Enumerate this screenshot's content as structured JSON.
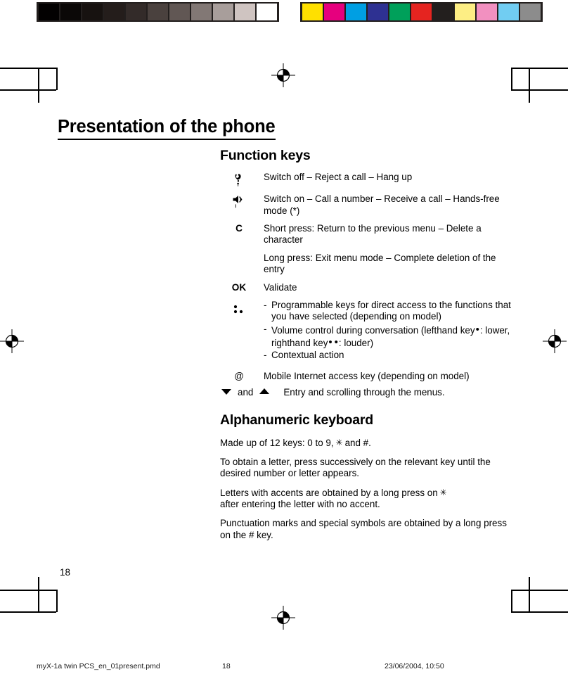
{
  "document": {
    "title": "Presentation of the phone",
    "page_number": "18"
  },
  "calibration": {
    "grayscale_swatches": [
      "#030101",
      "#0b0807",
      "#171210",
      "#241d1b",
      "#332b29",
      "#4a413e",
      "#615754",
      "#827875",
      "#a89e9b",
      "#cfc4c1",
      "#ffffff"
    ],
    "color_swatches": [
      "#ffe000",
      "#e6007e",
      "#009fe3",
      "#2e3192",
      "#00a05a",
      "#e52420",
      "#231f1e",
      "#fdee84",
      "#f290c0",
      "#71cdf2",
      "#8c8c8c"
    ]
  },
  "sections": [
    {
      "heading": "Function keys",
      "rows": [
        {
          "icon": "hangup-phone-icon",
          "key_label": "",
          "lines": [
            "Switch off – Reject a call – Hang up"
          ]
        },
        {
          "icon": "speaker-call-icon",
          "key_label": "",
          "lines": [
            "Switch on – Call a number – Receive a call – Hands-free mode (*)"
          ]
        },
        {
          "icon": "",
          "key_label": "C",
          "lines": [
            "Short press: Return to the previous menu – Delete a character"
          ]
        },
        {
          "icon": "",
          "key_label": "",
          "lines": [
            "Long press: Exit menu mode – Complete deletion of the entry"
          ]
        },
        {
          "icon": "",
          "key_label": "OK",
          "lines": [
            "Validate"
          ]
        }
      ],
      "soft_keys": {
        "icon": "three-dots-soft-keys-icon",
        "items": [
          "Programmable keys for direct access to the functions that you have selected (depending on model)",
          "Volume control during conversation (lefthand key",
          "Contextual action"
        ],
        "volume_part_a": "Volume control during conversation (lefthand key",
        "volume_part_b": ": lower, righthand key",
        "volume_part_c": ": louder)"
      },
      "at_row": {
        "key_label": "@",
        "text": "Mobile Internet access key (depending on model)"
      },
      "arrow_row": {
        "down_icon": "arrow-down-icon",
        "and_label": "and",
        "up_icon": "arrow-up-icon",
        "text": "Entry and scrolling through the menus."
      }
    },
    {
      "heading": "Alphanumeric keyboard",
      "paragraphs": [
        {
          "before": "Made up of 12 keys: 0 to 9,",
          "glyph": "star",
          "after": "and #."
        },
        {
          "before": "To obtain a letter, press successively on the relevant key until the desired number or letter appears.",
          "glyph": "",
          "after": ""
        },
        {
          "before": "Letters with accents are obtained by a long press on",
          "glyph": "star",
          "after": "after entering the letter with no accent."
        },
        {
          "before": "Punctuation marks and special symbols are obtained by a long press on the # key.",
          "glyph": "",
          "after": ""
        }
      ]
    }
  ],
  "footer": {
    "filename": "myX-1a twin PCS_en_01present.pmd",
    "page": "18",
    "timestamp": "23/06/2004, 10:50"
  }
}
